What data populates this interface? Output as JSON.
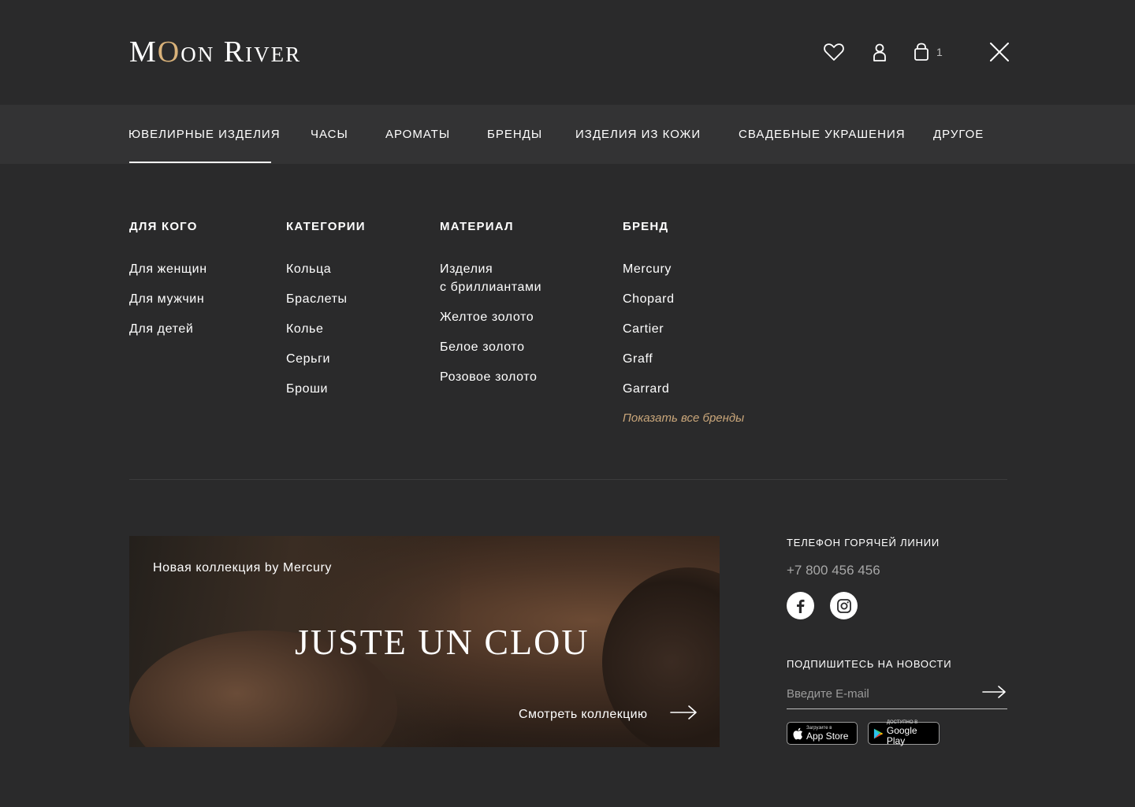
{
  "header": {
    "logo_part1": "Moon Ri",
    "logo_full": "Moon River",
    "logo": {
      "before_o": "M",
      "accent_o": "O",
      "after_o": "on River"
    },
    "cart_count": "1",
    "icons": [
      "heart-icon",
      "user-icon",
      "bag-icon",
      "close-icon"
    ]
  },
  "nav": {
    "items": [
      {
        "label": "ЮВЕЛИРНЫЕ ИЗДЕЛИЯ",
        "active": true
      },
      {
        "label": "ЧАСЫ"
      },
      {
        "label": "АРОМАТЫ"
      },
      {
        "label": "БРЕНДЫ"
      },
      {
        "label": "ИЗДЕЛИЯ ИЗ КОЖИ"
      },
      {
        "label": "СВАДЕБНЫЕ УКРАШЕНИЯ"
      },
      {
        "label": "ДРУГОЕ"
      }
    ]
  },
  "menu": {
    "for_whom": {
      "title": "ДЛЯ КОГО",
      "links": [
        "Для женщин",
        "Для мужчин",
        "Для детей"
      ]
    },
    "categories": {
      "title": "КАТЕГОРИИ",
      "links": [
        "Кольца",
        "Браслеты",
        "Колье",
        "Серьги",
        "Броши"
      ]
    },
    "material": {
      "title": "МАТЕРИАЛ",
      "links": [
        "Изделия",
        "с бриллиантами",
        "Желтое золото",
        "Белое золото",
        "Розовое золото"
      ]
    },
    "brand": {
      "title": "БРЕНД",
      "links": [
        "Mercury",
        "Chopard",
        "Cartier",
        "Graff",
        "Garrard"
      ],
      "show_all": "Показать все бренды"
    }
  },
  "banner": {
    "subtitle": "Новая коллекция by Mercury",
    "title": "JUSTE UN CLOU",
    "cta": "Смотреть коллекцию"
  },
  "sidebar": {
    "hotline_title": "ТЕЛЕФОН ГОРЯЧЕЙ ЛИНИИ",
    "phone": "+7 800 456 456",
    "newsletter_title": "ПОДПИШИТЕСЬ НА НОВОСТИ",
    "email_placeholder": "Введите E-mail",
    "app_store": {
      "small": "Загрузите в",
      "big": "App Store"
    },
    "google_play": {
      "small": "ДОСТУПНО В",
      "big": "Google Play"
    }
  },
  "colors": {
    "background": "#2a2a2b",
    "nav_bg": "#333334",
    "accent": "#c9a67a",
    "logo_accent": "#d9b27a"
  }
}
